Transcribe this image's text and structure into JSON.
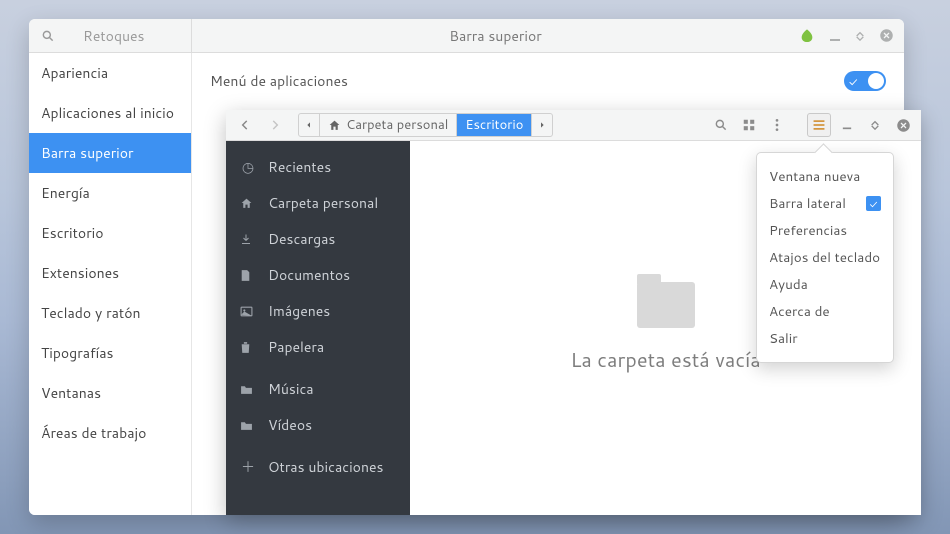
{
  "tweaks": {
    "app_name": "Retoques",
    "header_title": "Barra superior",
    "sidebar": [
      "Apariencia",
      "Aplicaciones al inicio",
      "Barra superior",
      "Energía",
      "Escritorio",
      "Extensiones",
      "Teclado y ratón",
      "Tipografías",
      "Ventanas",
      "Áreas de trabajo"
    ],
    "sidebar_active_index": 2,
    "content": {
      "row1_label": "Menú de aplicaciones",
      "row1_on": true
    }
  },
  "files": {
    "path": {
      "parent": "Carpeta personal",
      "current": "Escritorio"
    },
    "sidebar": {
      "recent": "Recientes",
      "home": "Carpeta personal",
      "downloads": "Descargas",
      "documents": "Documentos",
      "pictures": "Imágenes",
      "trash": "Papelera",
      "music": "Música",
      "videos": "Vídeos",
      "other": "Otras ubicaciones"
    },
    "empty_text": "La carpeta está vacía"
  },
  "popover": {
    "new_window": "Ventana nueva",
    "sidebar": "Barra lateral",
    "sidebar_checked": true,
    "preferences": "Preferencias",
    "shortcuts": "Atajos del teclado",
    "help": "Ayuda",
    "about": "Acerca de",
    "quit": "Salir"
  }
}
